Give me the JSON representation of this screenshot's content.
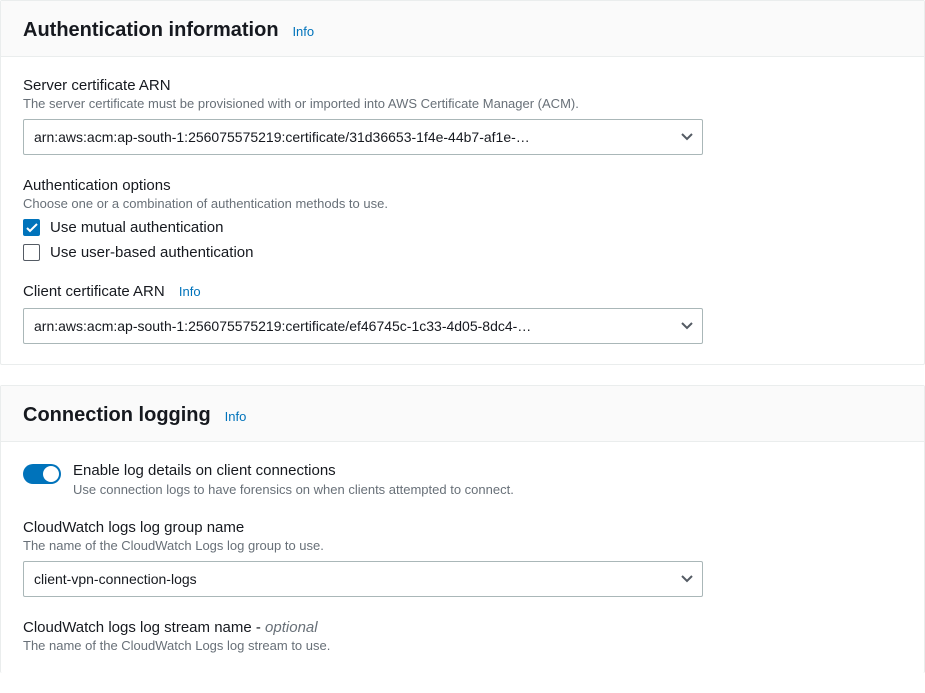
{
  "auth_panel": {
    "title": "Authentication information",
    "info": "Info",
    "server_cert": {
      "label": "Server certificate ARN",
      "desc": "The server certificate must be provisioned with or imported into AWS Certificate Manager (ACM).",
      "value": "arn:aws:acm:ap-south-1:256075575219:certificate/31d36653-1f4e-44b7-af1e-…"
    },
    "auth_options": {
      "label": "Authentication options",
      "desc": "Choose one or a combination of authentication methods to use.",
      "mutual_label": "Use mutual authentication",
      "user_label": "Use user-based authentication"
    },
    "client_cert": {
      "label": "Client certificate ARN",
      "info": "Info",
      "value": "arn:aws:acm:ap-south-1:256075575219:certificate/ef46745c-1c33-4d05-8dc4-…"
    }
  },
  "logging_panel": {
    "title": "Connection logging",
    "info": "Info",
    "enable_toggle": {
      "label": "Enable log details on client connections",
      "desc": "Use connection logs to have forensics on when clients attempted to connect."
    },
    "log_group": {
      "label": "CloudWatch logs log group name",
      "desc": "The name of the CloudWatch Logs log group to use.",
      "value": "client-vpn-connection-logs"
    },
    "log_stream": {
      "label_prefix": "CloudWatch logs log stream name - ",
      "optional": "optional",
      "desc": "The name of the CloudWatch Logs log stream to use."
    }
  }
}
